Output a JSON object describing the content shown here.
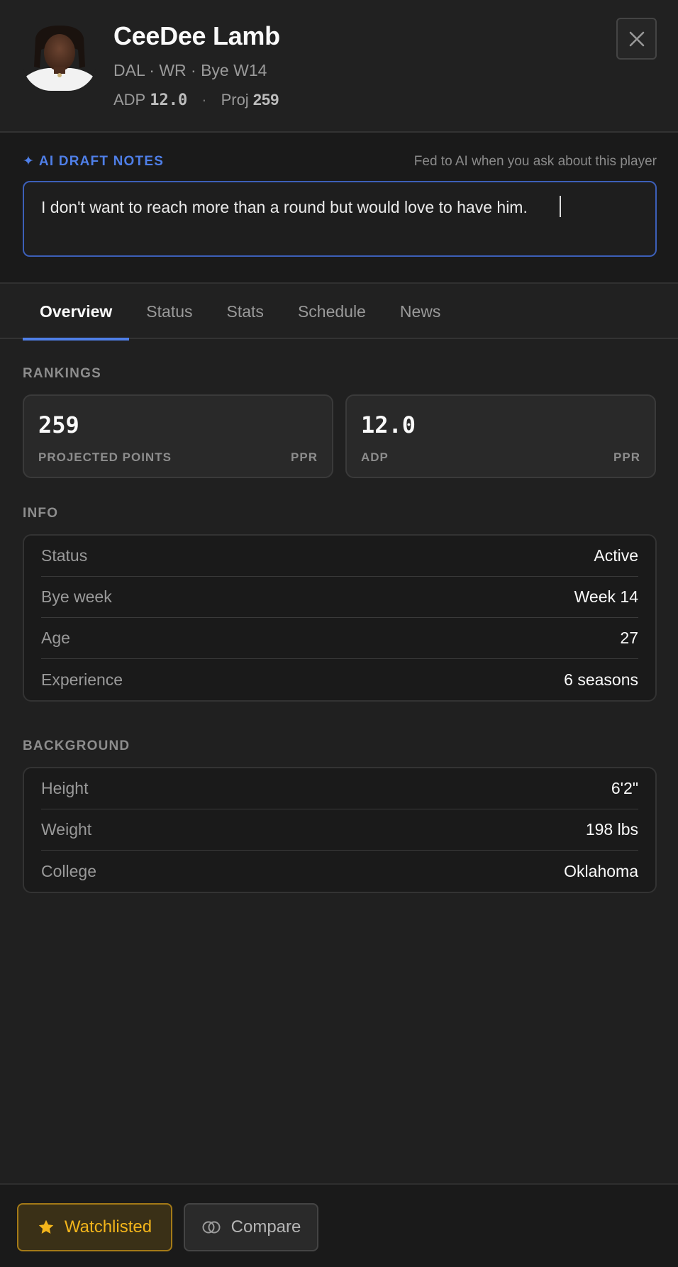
{
  "player": {
    "name": "CeeDee Lamb",
    "meta": "DAL · WR · Bye W14",
    "adp_label": "ADP",
    "adp_value": "12.0",
    "separator": "·",
    "proj_label": "Proj",
    "proj_value": "259"
  },
  "notes": {
    "title": "✦ AI DRAFT NOTES",
    "hint": "Fed to AI when you ask about this player",
    "text": "I don't want to reach more than a round but would love to have him."
  },
  "tabs": [
    {
      "label": "Overview"
    },
    {
      "label": "Status"
    },
    {
      "label": "Stats"
    },
    {
      "label": "Schedule"
    },
    {
      "label": "News"
    }
  ],
  "rankings": {
    "label": "RANKINGS",
    "cards": [
      {
        "value": "259",
        "label": "PROJECTED POINTS",
        "format": "PPR"
      },
      {
        "value": "12.0",
        "label": "ADP",
        "format": "PPR"
      }
    ]
  },
  "info": {
    "label": "INFO",
    "rows": [
      {
        "key": "Status",
        "value": "Active"
      },
      {
        "key": "Bye week",
        "value": "Week 14"
      },
      {
        "key": "Age",
        "value": "27"
      },
      {
        "key": "Experience",
        "value": "6 seasons"
      }
    ]
  },
  "background": {
    "label": "BACKGROUND",
    "rows": [
      {
        "key": "Height",
        "value": "6'2\""
      },
      {
        "key": "Weight",
        "value": "198 lbs"
      },
      {
        "key": "College",
        "value": "Oklahoma"
      }
    ]
  },
  "actions": {
    "watch_label": "Watchlisted",
    "compare_label": "Compare"
  },
  "icons": {
    "close": "close-icon",
    "star": "star-icon",
    "compare": "compare-icon"
  },
  "colors": {
    "accent": "#4f7fe8",
    "watch": "#f3b51b",
    "background": "#202020"
  }
}
